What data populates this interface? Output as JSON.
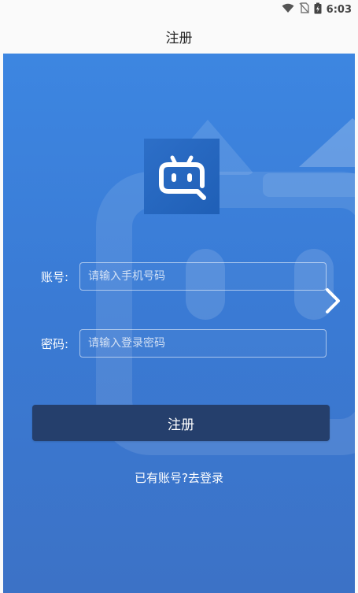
{
  "status_bar": {
    "time": "6:03",
    "icons": [
      "wifi-icon",
      "no-sim-icon",
      "battery-charging-icon"
    ]
  },
  "header": {
    "title": "注册"
  },
  "form": {
    "account_label": "账号:",
    "account_placeholder": "请输入手机号码",
    "account_value": "",
    "password_label": "密码:",
    "password_placeholder": "请输入登录密码",
    "password_value": "",
    "submit_label": "注册"
  },
  "footer": {
    "login_prompt": "已有账号?去登录"
  },
  "colors": {
    "accent_blue": "#3a7bd5",
    "button_dark": "#253f6c",
    "text_on_blue": "#ffffff"
  }
}
